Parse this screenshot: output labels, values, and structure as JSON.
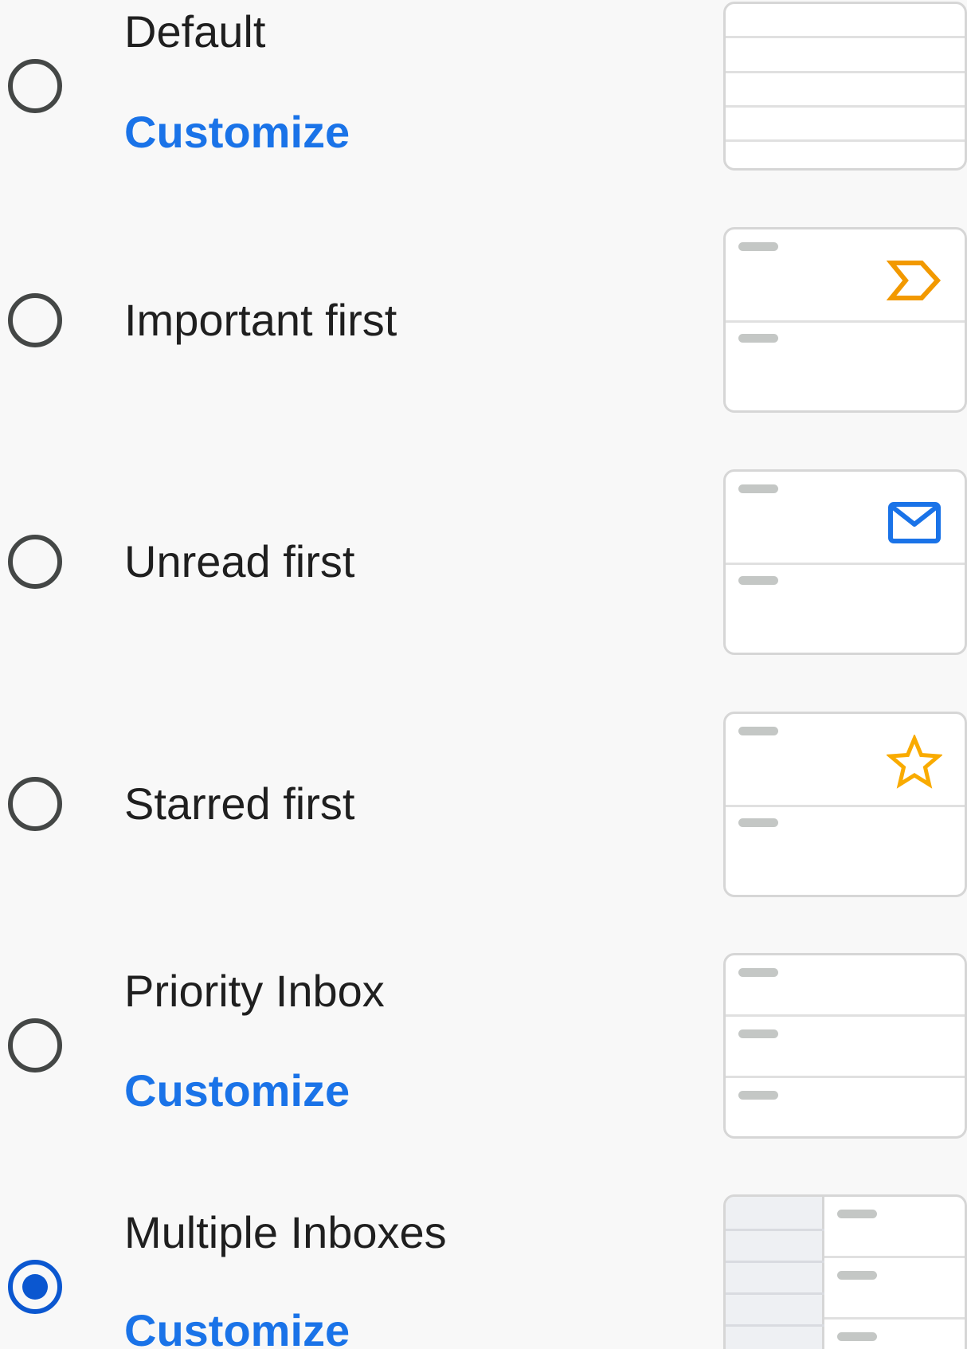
{
  "inbox_type": {
    "selected": "Multiple Inboxes",
    "options": [
      {
        "label": "Default",
        "customize": "Customize",
        "selected": false,
        "preview": "plain-rows"
      },
      {
        "label": "Important first",
        "selected": false,
        "preview": "important-marker-icon"
      },
      {
        "label": "Unread first",
        "selected": false,
        "preview": "envelope-icon"
      },
      {
        "label": "Starred first",
        "selected": false,
        "preview": "star-icon"
      },
      {
        "label": "Priority Inbox",
        "customize": "Customize",
        "selected": false,
        "preview": "sectioned-rows"
      },
      {
        "label": "Multiple Inboxes",
        "customize": "Customize",
        "selected": true,
        "preview": "split-pane"
      }
    ]
  },
  "colors": {
    "link": "#1a73e8",
    "radio_selected": "#0b57d0",
    "radio_unselected": "#444746",
    "important_icon": "#f29900",
    "envelope_icon": "#1a73e8",
    "star_icon": "#f9ab00",
    "background": "#f8f8f8"
  }
}
